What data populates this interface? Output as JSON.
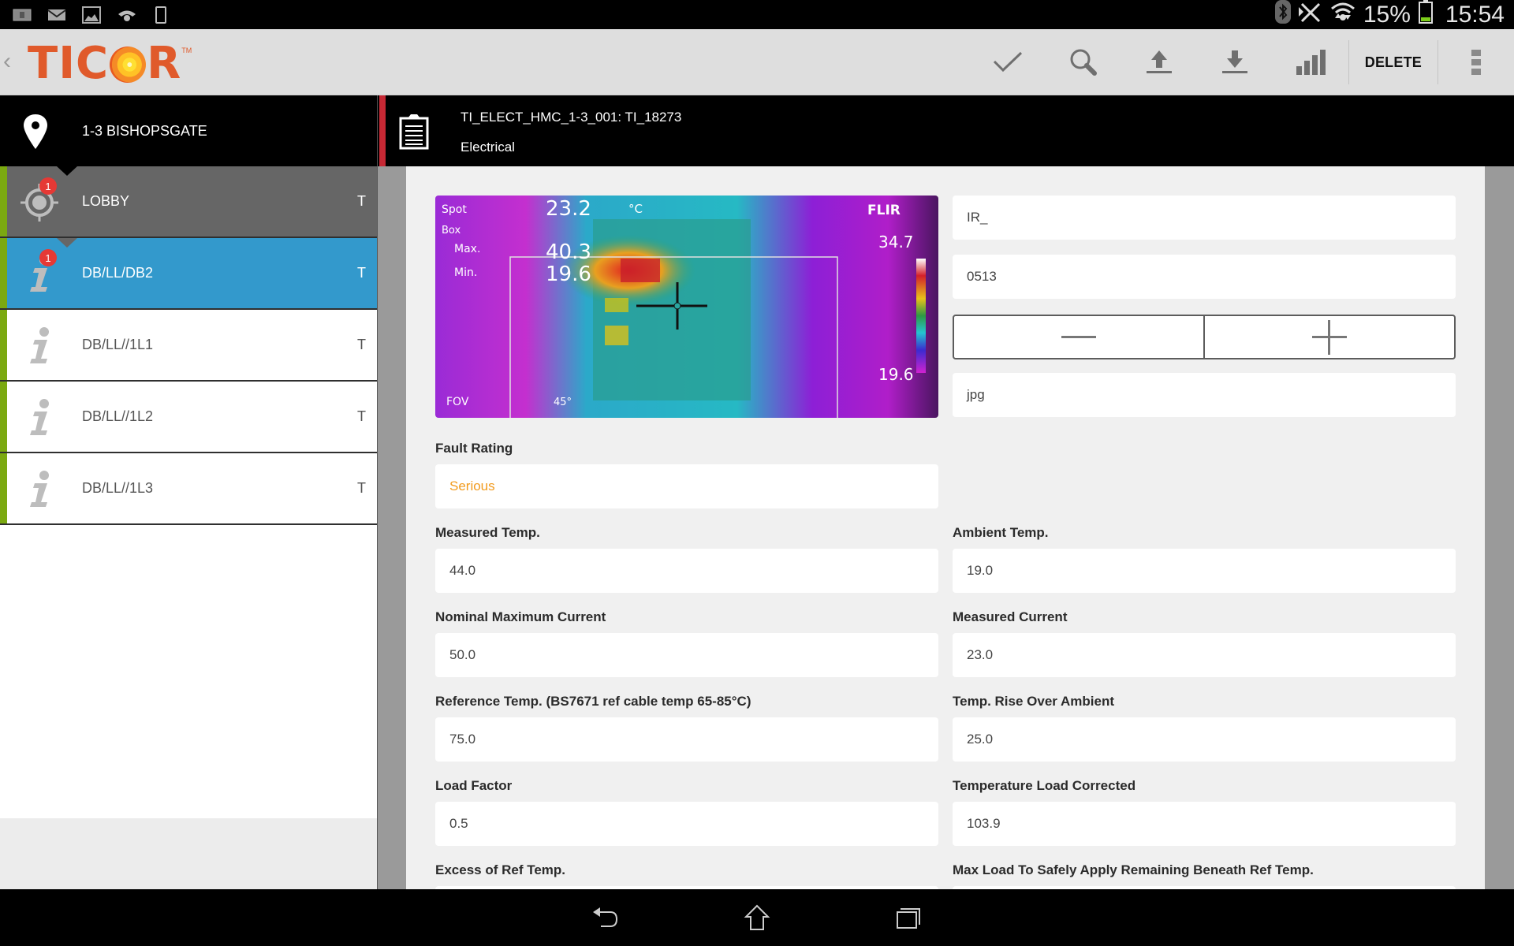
{
  "status_bar": {
    "left_icons": [
      "info-notification-icon",
      "mail-icon",
      "image-icon",
      "missed-call-icon",
      "phone-device-icon"
    ],
    "right_icons": [
      "bluetooth-icon",
      "no-signal-icon",
      "wifi-icon"
    ],
    "battery_percent": "15%",
    "battery_level": 0.15,
    "time": "15:54"
  },
  "action_bar": {
    "logo_text_left": "TIC",
    "logo_text_right": "R",
    "logo_tm": "TM",
    "actions": [
      {
        "name": "check-icon",
        "label": "Save"
      },
      {
        "name": "search-icon",
        "label": "Search"
      },
      {
        "name": "upload-icon",
        "label": "Upload"
      },
      {
        "name": "download-icon",
        "label": "Download"
      },
      {
        "name": "signal-bars-icon",
        "label": "Stats"
      }
    ],
    "delete_label": "DELETE"
  },
  "sidebar": {
    "location": "1-3 BISHOPSGATE",
    "items": [
      {
        "label": "LOBBY",
        "tag": "T",
        "badge": "1",
        "icon": "target-icon",
        "state": "parent"
      },
      {
        "label": "DB/LL/DB2",
        "tag": "T",
        "badge": "1",
        "icon": "info-icon",
        "state": "selected"
      },
      {
        "label": "DB/LL//1L1",
        "tag": "T",
        "badge": null,
        "icon": "info-icon",
        "state": "normal"
      },
      {
        "label": "DB/LL//1L2",
        "tag": "T",
        "badge": null,
        "icon": "info-icon",
        "state": "normal"
      },
      {
        "label": "DB/LL//1L3",
        "tag": "T",
        "badge": null,
        "icon": "info-icon",
        "state": "normal"
      }
    ]
  },
  "main": {
    "inspection_id": "TI_ELECT_HMC_1-3_001: TI_18273",
    "inspection_type": "Electrical",
    "thermal_image": {
      "spot_label": "Spot",
      "spot_value": "23.2",
      "unit": "°C",
      "box_label": "Box",
      "max_label": "Max.",
      "max_value": "40.3",
      "min_label": "Min.",
      "min_value": "19.6",
      "brand": "FLIR",
      "scale_max": "34.7",
      "scale_min": "19.6",
      "fov_label": "FOV",
      "fov_value": "45°"
    },
    "image_prefix": "IR_",
    "image_number": "0513",
    "image_ext": "jpg",
    "fields": {
      "fault_rating": {
        "label": "Fault Rating",
        "value": "Serious"
      },
      "measured_temp": {
        "label": "Measured Temp.",
        "value": "44.0"
      },
      "ambient_temp": {
        "label": "Ambient Temp.",
        "value": "19.0"
      },
      "nominal_max_current": {
        "label": "Nominal Maximum Current",
        "value": "50.0"
      },
      "measured_current": {
        "label": "Measured Current",
        "value": "23.0"
      },
      "reference_temp": {
        "label": "Reference Temp. (BS7671 ref cable temp 65-85°C)",
        "value": "75.0"
      },
      "temp_rise": {
        "label": "Temp. Rise Over Ambient",
        "value": "25.0"
      },
      "load_factor": {
        "label": "Load Factor",
        "value": "0.5"
      },
      "temp_load_corrected": {
        "label": "Temperature Load Corrected",
        "value": "103.9"
      },
      "excess_ref_temp": {
        "label": "Excess of Ref Temp.",
        "value": ""
      },
      "max_load_safe": {
        "label": "Max Load To Safely Apply Remaining Beneath Ref Temp.",
        "value": ""
      }
    }
  },
  "colors": {
    "accent_blue": "#3399cc",
    "status_green": "#7ba911",
    "header_red": "#c62834",
    "serious_orange": "#f29b1d",
    "badge_red": "#e53935",
    "logo_orange": "#e05a2b"
  }
}
